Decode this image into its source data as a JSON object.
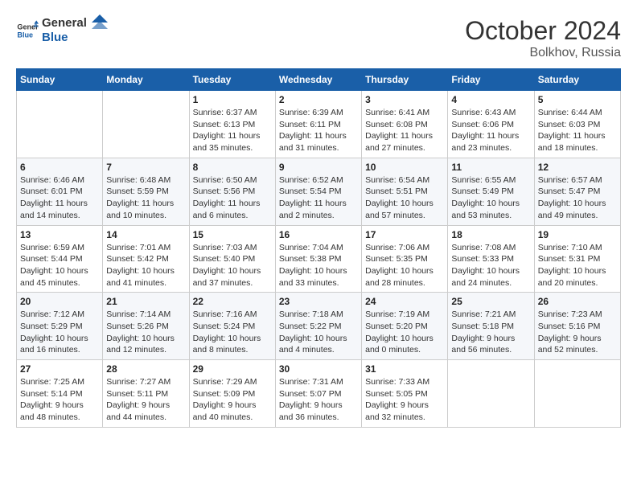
{
  "header": {
    "logo_line1": "General",
    "logo_line2": "Blue",
    "month": "October 2024",
    "location": "Bolkhov, Russia"
  },
  "days_of_week": [
    "Sunday",
    "Monday",
    "Tuesday",
    "Wednesday",
    "Thursday",
    "Friday",
    "Saturday"
  ],
  "weeks": [
    [
      {
        "day": "",
        "content": ""
      },
      {
        "day": "",
        "content": ""
      },
      {
        "day": "1",
        "content": "Sunrise: 6:37 AM\nSunset: 6:13 PM\nDaylight: 11 hours\nand 35 minutes."
      },
      {
        "day": "2",
        "content": "Sunrise: 6:39 AM\nSunset: 6:11 PM\nDaylight: 11 hours\nand 31 minutes."
      },
      {
        "day": "3",
        "content": "Sunrise: 6:41 AM\nSunset: 6:08 PM\nDaylight: 11 hours\nand 27 minutes."
      },
      {
        "day": "4",
        "content": "Sunrise: 6:43 AM\nSunset: 6:06 PM\nDaylight: 11 hours\nand 23 minutes."
      },
      {
        "day": "5",
        "content": "Sunrise: 6:44 AM\nSunset: 6:03 PM\nDaylight: 11 hours\nand 18 minutes."
      }
    ],
    [
      {
        "day": "6",
        "content": "Sunrise: 6:46 AM\nSunset: 6:01 PM\nDaylight: 11 hours\nand 14 minutes."
      },
      {
        "day": "7",
        "content": "Sunrise: 6:48 AM\nSunset: 5:59 PM\nDaylight: 11 hours\nand 10 minutes."
      },
      {
        "day": "8",
        "content": "Sunrise: 6:50 AM\nSunset: 5:56 PM\nDaylight: 11 hours\nand 6 minutes."
      },
      {
        "day": "9",
        "content": "Sunrise: 6:52 AM\nSunset: 5:54 PM\nDaylight: 11 hours\nand 2 minutes."
      },
      {
        "day": "10",
        "content": "Sunrise: 6:54 AM\nSunset: 5:51 PM\nDaylight: 10 hours\nand 57 minutes."
      },
      {
        "day": "11",
        "content": "Sunrise: 6:55 AM\nSunset: 5:49 PM\nDaylight: 10 hours\nand 53 minutes."
      },
      {
        "day": "12",
        "content": "Sunrise: 6:57 AM\nSunset: 5:47 PM\nDaylight: 10 hours\nand 49 minutes."
      }
    ],
    [
      {
        "day": "13",
        "content": "Sunrise: 6:59 AM\nSunset: 5:44 PM\nDaylight: 10 hours\nand 45 minutes."
      },
      {
        "day": "14",
        "content": "Sunrise: 7:01 AM\nSunset: 5:42 PM\nDaylight: 10 hours\nand 41 minutes."
      },
      {
        "day": "15",
        "content": "Sunrise: 7:03 AM\nSunset: 5:40 PM\nDaylight: 10 hours\nand 37 minutes."
      },
      {
        "day": "16",
        "content": "Sunrise: 7:04 AM\nSunset: 5:38 PM\nDaylight: 10 hours\nand 33 minutes."
      },
      {
        "day": "17",
        "content": "Sunrise: 7:06 AM\nSunset: 5:35 PM\nDaylight: 10 hours\nand 28 minutes."
      },
      {
        "day": "18",
        "content": "Sunrise: 7:08 AM\nSunset: 5:33 PM\nDaylight: 10 hours\nand 24 minutes."
      },
      {
        "day": "19",
        "content": "Sunrise: 7:10 AM\nSunset: 5:31 PM\nDaylight: 10 hours\nand 20 minutes."
      }
    ],
    [
      {
        "day": "20",
        "content": "Sunrise: 7:12 AM\nSunset: 5:29 PM\nDaylight: 10 hours\nand 16 minutes."
      },
      {
        "day": "21",
        "content": "Sunrise: 7:14 AM\nSunset: 5:26 PM\nDaylight: 10 hours\nand 12 minutes."
      },
      {
        "day": "22",
        "content": "Sunrise: 7:16 AM\nSunset: 5:24 PM\nDaylight: 10 hours\nand 8 minutes."
      },
      {
        "day": "23",
        "content": "Sunrise: 7:18 AM\nSunset: 5:22 PM\nDaylight: 10 hours\nand 4 minutes."
      },
      {
        "day": "24",
        "content": "Sunrise: 7:19 AM\nSunset: 5:20 PM\nDaylight: 10 hours\nand 0 minutes."
      },
      {
        "day": "25",
        "content": "Sunrise: 7:21 AM\nSunset: 5:18 PM\nDaylight: 9 hours\nand 56 minutes."
      },
      {
        "day": "26",
        "content": "Sunrise: 7:23 AM\nSunset: 5:16 PM\nDaylight: 9 hours\nand 52 minutes."
      }
    ],
    [
      {
        "day": "27",
        "content": "Sunrise: 7:25 AM\nSunset: 5:14 PM\nDaylight: 9 hours\nand 48 minutes."
      },
      {
        "day": "28",
        "content": "Sunrise: 7:27 AM\nSunset: 5:11 PM\nDaylight: 9 hours\nand 44 minutes."
      },
      {
        "day": "29",
        "content": "Sunrise: 7:29 AM\nSunset: 5:09 PM\nDaylight: 9 hours\nand 40 minutes."
      },
      {
        "day": "30",
        "content": "Sunrise: 7:31 AM\nSunset: 5:07 PM\nDaylight: 9 hours\nand 36 minutes."
      },
      {
        "day": "31",
        "content": "Sunrise: 7:33 AM\nSunset: 5:05 PM\nDaylight: 9 hours\nand 32 minutes."
      },
      {
        "day": "",
        "content": ""
      },
      {
        "day": "",
        "content": ""
      }
    ]
  ]
}
